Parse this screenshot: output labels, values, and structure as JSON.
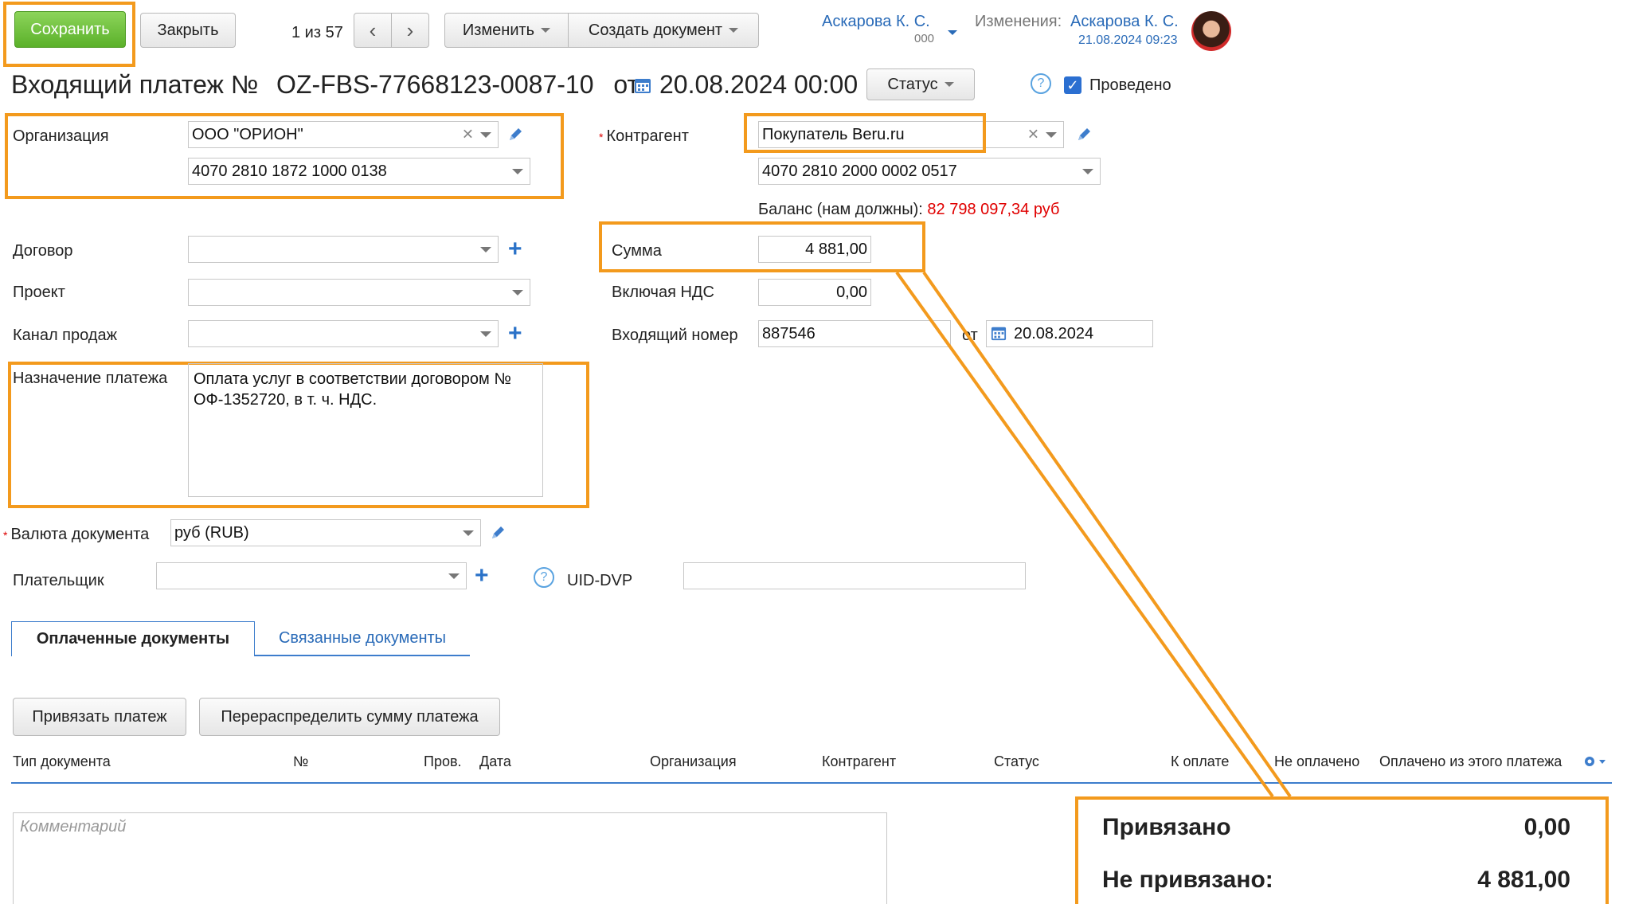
{
  "toolbar": {
    "save_label": "Сохранить",
    "close_label": "Закрыть",
    "pager": "1 из 57",
    "change_label": "Изменить",
    "create_doc_label": "Создать документ",
    "user_name": "Аскарова К. С.",
    "user_sub": "000",
    "changes_label": "Изменения:",
    "changes_user": "Аскарова К. С.",
    "changes_date": "21.08.2024 09:23"
  },
  "header": {
    "title": "Входящий платеж №",
    "number": "OZ-FBS-77668123-0087-10",
    "from": "от",
    "date": "20.08.2024 00:00",
    "status_label": "Статус",
    "posted_label": "Проведено"
  },
  "form": {
    "org_label": "Организация",
    "org_value": "ООО \"ОРИОН\"",
    "org_account": "4070 2810 1872 1000 0138",
    "counterparty_label": "Контрагент",
    "counterparty_value": "Покупатель Beru.ru",
    "counterparty_account": "4070 2810 2000 0002 0517",
    "balance_label": "Баланс (нам должны):",
    "balance_value": "82 798 097,34 руб",
    "contract_label": "Договор",
    "project_label": "Проект",
    "channel_label": "Канал продаж",
    "sum_label": "Сумма",
    "sum_value": "4 881,00",
    "vat_label": "Включая НДС",
    "vat_value": "0,00",
    "incoming_label": "Входящий номер",
    "incoming_value": "887546",
    "incoming_from": "от",
    "incoming_date": "20.08.2024",
    "purpose_label": "Назначение платежа",
    "purpose_value": "Оплата услуг в соответствии договором № ОФ-1352720, в т. ч. НДС.",
    "currency_label": "Валюта документа",
    "currency_value": "руб (RUB)",
    "payer_label": "Плательщик",
    "uid_label": "UID-DVP"
  },
  "tabs": {
    "paid": "Оплаченные документы",
    "linked": "Связанные документы"
  },
  "actions": {
    "bind": "Привязать платеж",
    "redistribute": "Перераспределить сумму платежа"
  },
  "table": {
    "columns": [
      "Тип документа",
      "№",
      "Пров.",
      "Дата",
      "Организация",
      "Контрагент",
      "Статус",
      "К оплате",
      "Не оплачено",
      "Оплачено из этого платежа"
    ]
  },
  "comment_placeholder": "Комментарий",
  "summary": {
    "bound_label": "Привязано",
    "bound_value": "0,00",
    "unbound_label": "Не привязано:",
    "unbound_value": "4 881,00"
  },
  "colors": {
    "highlight": "#f39a1d",
    "link": "#2a6bb8",
    "balance": "#e00000",
    "save_green": "#6cbf3a"
  }
}
